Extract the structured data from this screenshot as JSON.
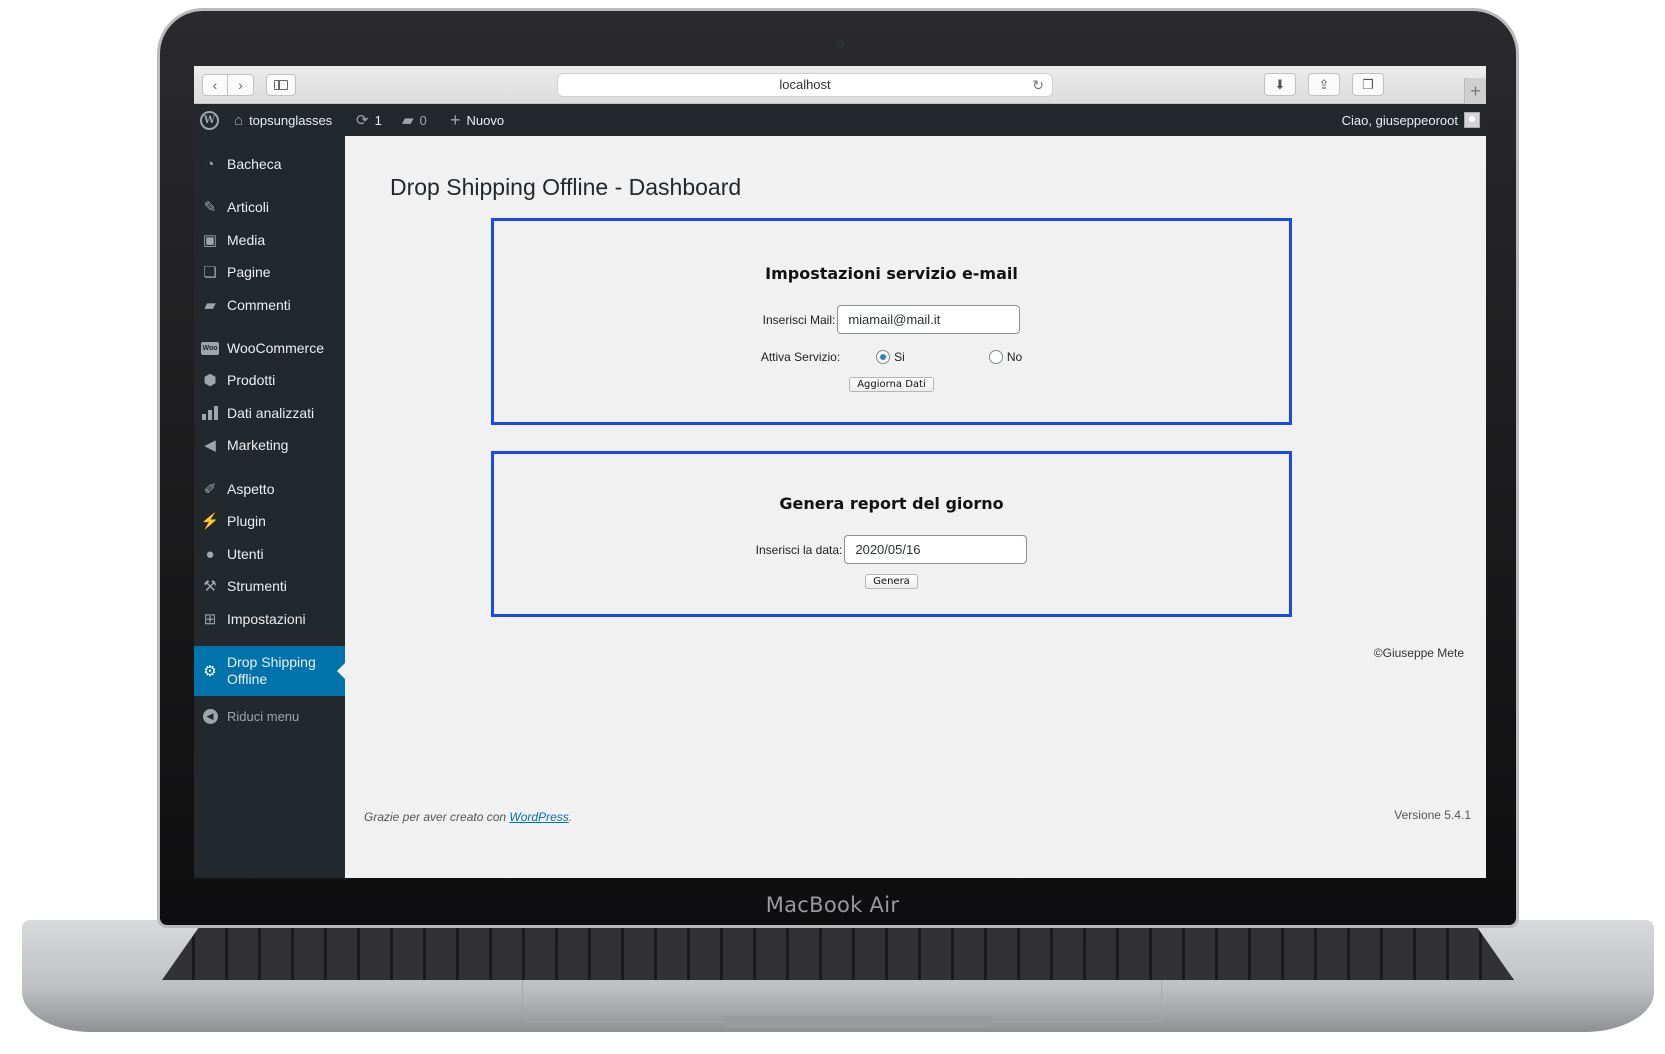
{
  "device": {
    "label": "MacBook Air"
  },
  "browser": {
    "url": "localhost"
  },
  "adminbar": {
    "site_name": "topsunglasses",
    "updates_count": "1",
    "comments_count": "0",
    "new_label": "Nuovo",
    "greeting": "Ciao, giuseppeoroot"
  },
  "sidebar": {
    "items": [
      {
        "label": "Bacheca",
        "icon": "dashboard-icon"
      },
      {
        "label": "Articoli",
        "icon": "pin-icon"
      },
      {
        "label": "Media",
        "icon": "media-icon"
      },
      {
        "label": "Pagine",
        "icon": "pages-icon"
      },
      {
        "label": "Commenti",
        "icon": "comment-icon"
      },
      {
        "label": "WooCommerce",
        "icon": "woocommerce-icon"
      },
      {
        "label": "Prodotti",
        "icon": "box-icon"
      },
      {
        "label": "Dati analizzati",
        "icon": "bar-chart-icon"
      },
      {
        "label": "Marketing",
        "icon": "megaphone-icon"
      },
      {
        "label": "Aspetto",
        "icon": "brush-icon"
      },
      {
        "label": "Plugin",
        "icon": "plug-icon"
      },
      {
        "label": "Utenti",
        "icon": "user-icon"
      },
      {
        "label": "Strumenti",
        "icon": "wrench-icon"
      },
      {
        "label": "Impostazioni",
        "icon": "settings-icon"
      }
    ],
    "active": {
      "label_line1": "Drop Shipping",
      "label_line2": "Offline",
      "icon": "gear-icon"
    },
    "collapse_label": "Riduci menu",
    "accent_color": "#0073aa"
  },
  "main": {
    "title": "Drop Shipping Offline - Dashboard",
    "email_panel": {
      "heading": "Impostazioni servizio e-mail",
      "mail_label": "Inserisci Mail:",
      "mail_value": "miamail@mail.it",
      "service_label": "Attiva Servizio:",
      "option_yes": "Si",
      "option_no": "No",
      "selected": "Si",
      "button": "Aggiorna Dati"
    },
    "report_panel": {
      "heading": "Genera report del giorno",
      "date_label": "Inserisci la data:",
      "date_value": "2020/05/16",
      "button": "Genera"
    },
    "copyright": "©Giuseppe Mete",
    "panel_border_color": "#1a4be6"
  },
  "footer": {
    "thanks_prefix": "Grazie per aver creato con",
    "thanks_link": "WordPress",
    "thanks_suffix": ".",
    "version": "Versione 5.4.1"
  }
}
